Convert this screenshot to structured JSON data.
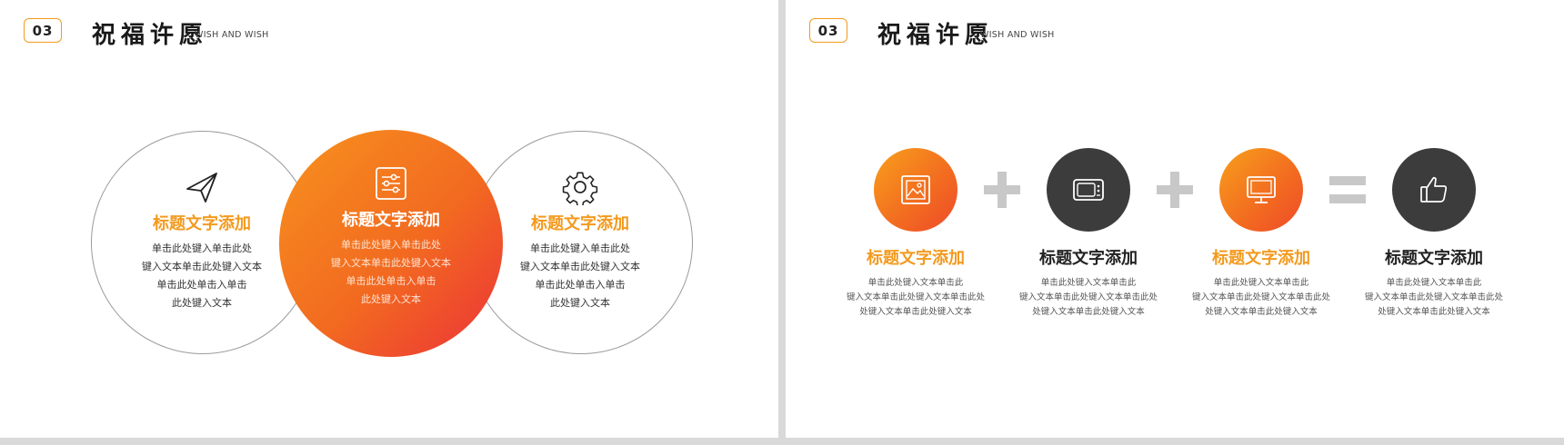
{
  "header": {
    "badge": "03",
    "title": "祝福许愿",
    "subtitle": "WISH AND WISH"
  },
  "left_slide": {
    "circles": [
      {
        "icon": "paper-plane-icon",
        "title": "标题文字添加",
        "lines": [
          "单击此处键入单击此处",
          "键入文本单击此处键入文本",
          "单击此处单击入单击",
          "此处键入文本"
        ]
      },
      {
        "icon": "sliders-icon",
        "title": "标题文字添加",
        "lines": [
          "单击此处键入单击此处",
          "键入文本单击此处键入文本",
          "单击此处单击入单击",
          "此处键入文本"
        ]
      },
      {
        "icon": "gear-icon",
        "title": "标题文字添加",
        "lines": [
          "单击此处键入单击此处",
          "键入文本单击此处键入文本",
          "单击此处单击入单击",
          "此处键入文本"
        ]
      }
    ]
  },
  "right_slide": {
    "items": [
      {
        "icon": "image-icon",
        "title": "标题文字添加",
        "lines": [
          "单击此处键入文本单击此",
          "键入文本单击此处键入文本单击此处",
          "处键入文本单击此处键入文本"
        ]
      },
      {
        "icon": "tv-icon",
        "title": "标题文字添加",
        "lines": [
          "单击此处键入文本单击此",
          "键入文本单击此处键入文本单击此处",
          "处键入文本单击此处键入文本"
        ]
      },
      {
        "icon": "monitor-icon",
        "title": "标题文字添加",
        "lines": [
          "单击此处键入文本单击此",
          "键入文本单击此处键入文本单击此处",
          "处键入文本单击此处键入文本"
        ]
      },
      {
        "icon": "thumbs-up-icon",
        "title": "标题文字添加",
        "lines": [
          "单击此处键入文本单击此",
          "键入文本单击此处键入文本单击此处",
          "处键入文本单击此处键入文本"
        ]
      }
    ],
    "operators": [
      "plus-icon",
      "plus-icon",
      "equals-icon"
    ]
  },
  "colors": {
    "accent_orange": "#f39a1e",
    "gradient_end": "#ec3238",
    "dark_circle": "#3c3c3c",
    "operator_gray": "#c8c8c8"
  }
}
